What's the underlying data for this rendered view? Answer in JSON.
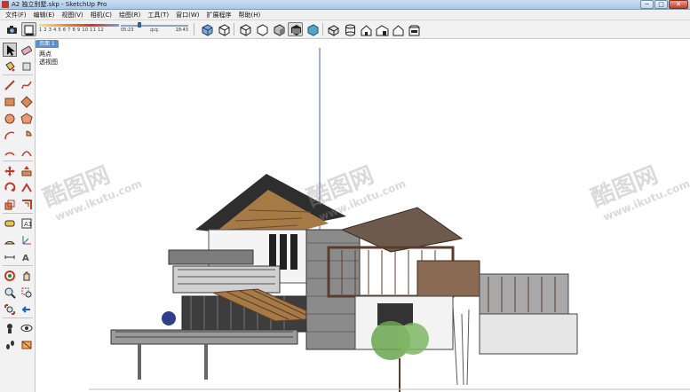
{
  "window": {
    "title": "A2 独立别墅.skp - SketchUp Pro",
    "minimize_glyph": "─",
    "maximize_glyph": "□",
    "close_glyph": "✕"
  },
  "menu": {
    "items": [
      "文件(F)",
      "编辑(E)",
      "视图(V)",
      "相机(C)",
      "绘图(R)",
      "工具(T)",
      "窗口(W)",
      "扩展程序",
      "帮助(H)"
    ]
  },
  "shadow_settings": {
    "months": "1 2 3 4 5 6 7 8 9 10 11 12",
    "time_start": "05:23",
    "time_noon": "中午",
    "time_end": "18:43",
    "time_fraction": 0.27
  },
  "scene": {
    "tab_label": "页面 1"
  },
  "viewport": {
    "style_label": "两点",
    "view_label": "透视图",
    "background": "#ffffff"
  },
  "watermark": {
    "brand": "酷图网",
    "url": "www.ikutu.com"
  },
  "colors": {
    "accent": "#5a8fd0",
    "axis_blue": "#4b5fb8",
    "roof_wood": "#a67a45",
    "frame_brown": "#5b3c2c",
    "foliage": "#69a64f"
  },
  "toolbar": {
    "icons": [
      "camera-icon",
      "shadow-toggle-icon",
      "xray-style-icon",
      "back-edges-style-icon",
      "wireframe-style-icon",
      "hidden-line-style-icon",
      "shaded-style-icon",
      "shaded-textures-style-icon",
      "monochrome-style-icon",
      "iso-view-icon",
      "top-view-icon",
      "front-view-icon",
      "right-view-icon",
      "back-view-icon",
      "left-view-icon"
    ]
  },
  "palette": {
    "tools": [
      "select-icon",
      "eraser-icon",
      "paint-bucket-icon",
      "eraser-alt-icon",
      "line-icon",
      "freehand-icon",
      "rectangle-icon",
      "rotated-rectangle-icon",
      "circle-icon",
      "polygon-icon",
      "arc-icon",
      "pie-icon",
      "two-point-arc-icon",
      "three-point-arc-icon",
      "move-icon",
      "push-pull-icon",
      "rotate-icon",
      "follow-me-icon",
      "scale-icon",
      "offset-icon",
      "tape-measure-icon",
      "text-icon",
      "protractor-icon",
      "axes-icon",
      "dimension-icon",
      "3d-text-icon",
      "orbit-icon",
      "pan-icon",
      "zoom-icon",
      "zoom-window-icon",
      "zoom-extents-icon",
      "previous-view-icon",
      "position-camera-icon",
      "look-around-icon",
      "walk-icon",
      "section-plane-icon"
    ]
  }
}
